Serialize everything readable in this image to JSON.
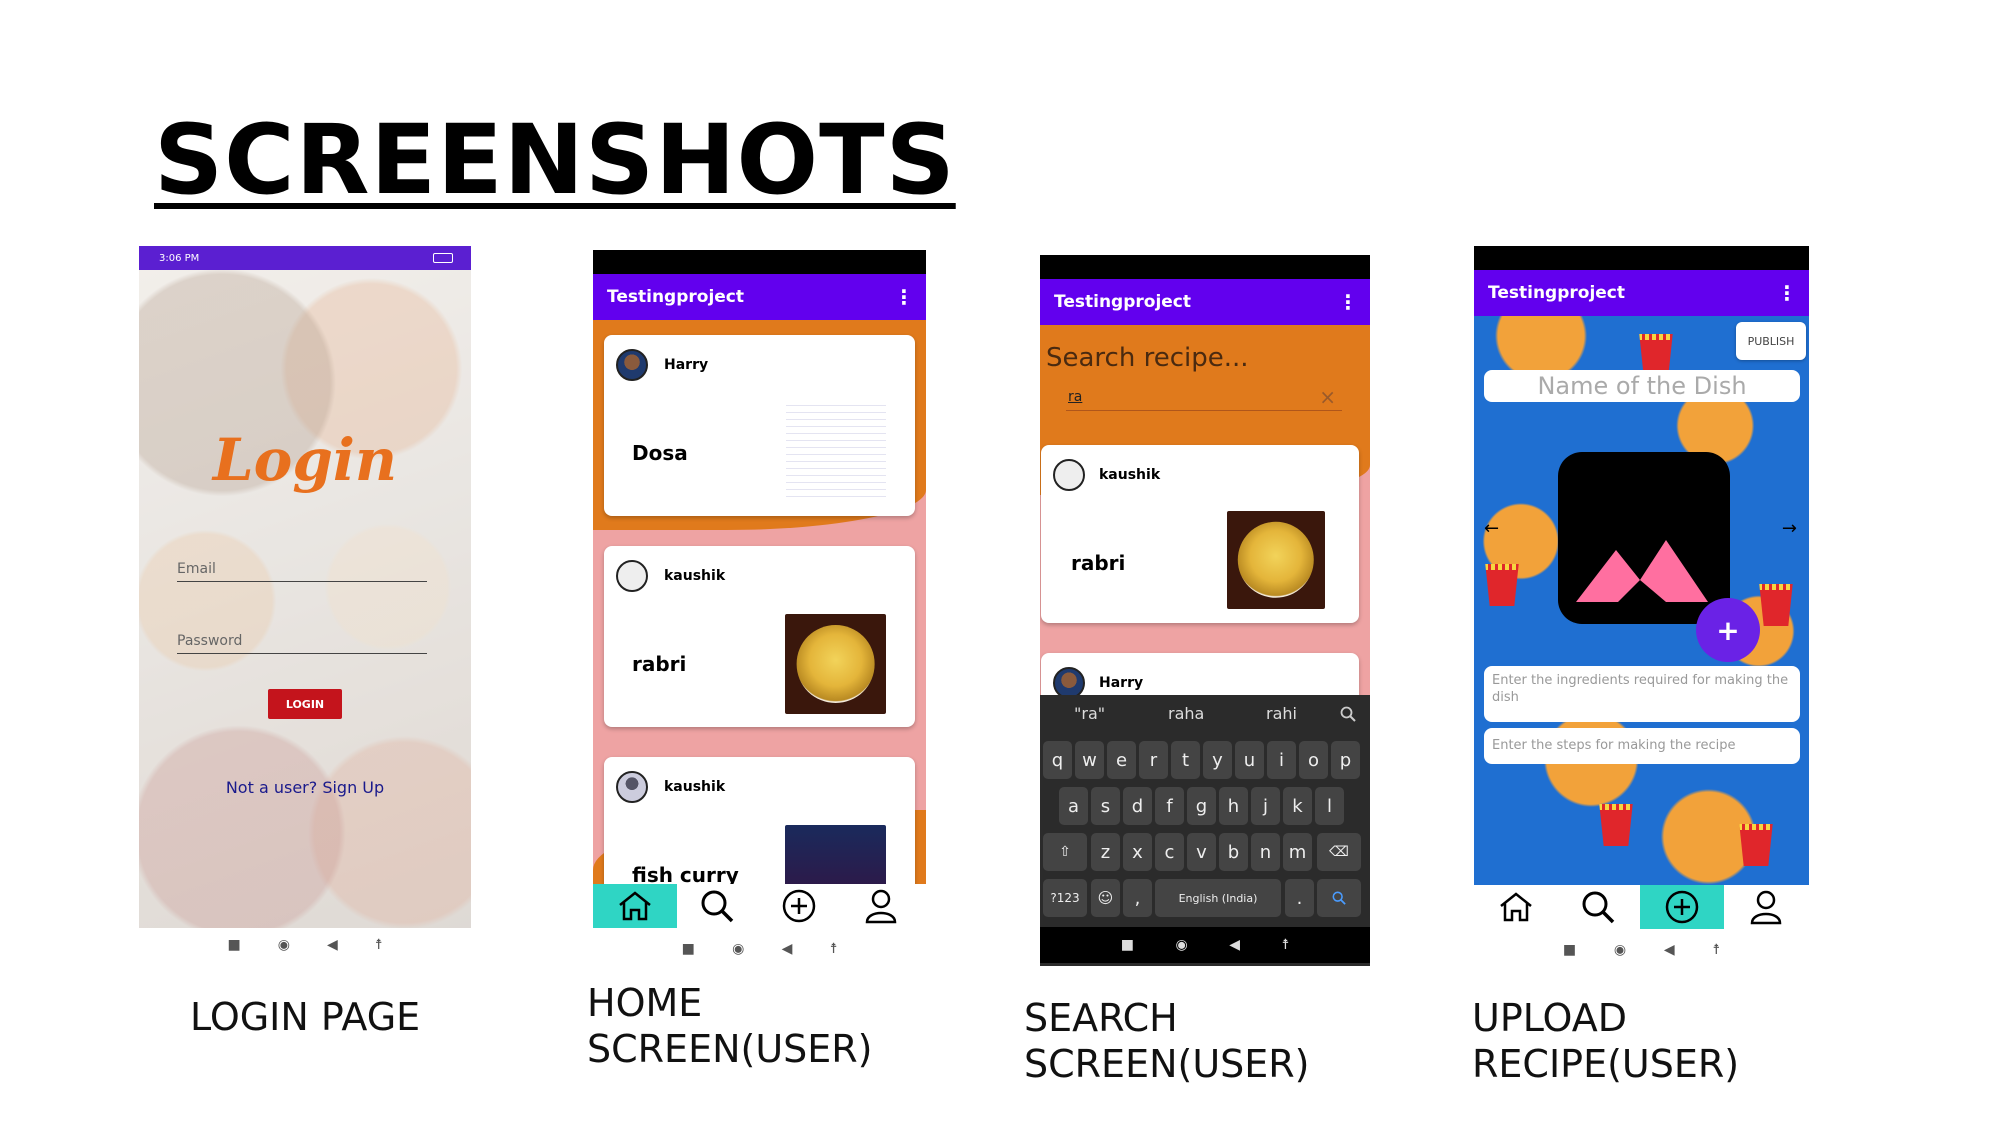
{
  "title": "SCREENSHOTS",
  "captions": {
    "login": "LOGIN PAGE",
    "home": "HOME SCREEN(USER)",
    "search": "SEARCH SCREEN(USER)",
    "upload": "UPLOAD RECIPE(USER)"
  },
  "login": {
    "status_time": "3:06 PM",
    "heading": "Login",
    "email_placeholder": "Email",
    "password_placeholder": "Password",
    "login_button": "LOGIN",
    "signup_link": "Not a user? Sign Up"
  },
  "home": {
    "app_title": "Testingproject",
    "posts": [
      {
        "user": "Harry",
        "dish": "Dosa"
      },
      {
        "user": "kaushik",
        "dish": "rabri"
      },
      {
        "user": "kaushik",
        "dish": "fish curry"
      }
    ]
  },
  "search": {
    "app_title": "Testingproject",
    "search_heading": "Search recipe...",
    "query": "ra",
    "clear_icon": "×",
    "results": [
      {
        "user": "kaushik",
        "dish": "rabri"
      },
      {
        "user": "Harry",
        "dish": ""
      }
    ],
    "suggestions": [
      "\"ra\"",
      "raha",
      "rahi"
    ],
    "keyboard": {
      "row1": [
        "q",
        "w",
        "e",
        "r",
        "t",
        "y",
        "u",
        "i",
        "o",
        "p"
      ],
      "row2": [
        "a",
        "s",
        "d",
        "f",
        "g",
        "h",
        "j",
        "k",
        "l"
      ],
      "row3": [
        "z",
        "x",
        "c",
        "v",
        "b",
        "n",
        "m"
      ],
      "numbers_key": "?123",
      "space_label": "English (India)"
    }
  },
  "upload": {
    "app_title": "Testingproject",
    "publish_button": "PUBLISH",
    "name_placeholder": "Name of the Dish",
    "add_symbol": "+",
    "ingredients_placeholder": "Enter the ingredients required for making the dish",
    "steps_placeholder": "Enter the steps for making the recipe"
  },
  "colors": {
    "appbar": "#6200ee",
    "orange": "#e07a1c",
    "pink": "#eea3a3",
    "nav_active": "#2fd5c4",
    "login_red": "#c4141c",
    "login_orange": "#e8701e"
  }
}
